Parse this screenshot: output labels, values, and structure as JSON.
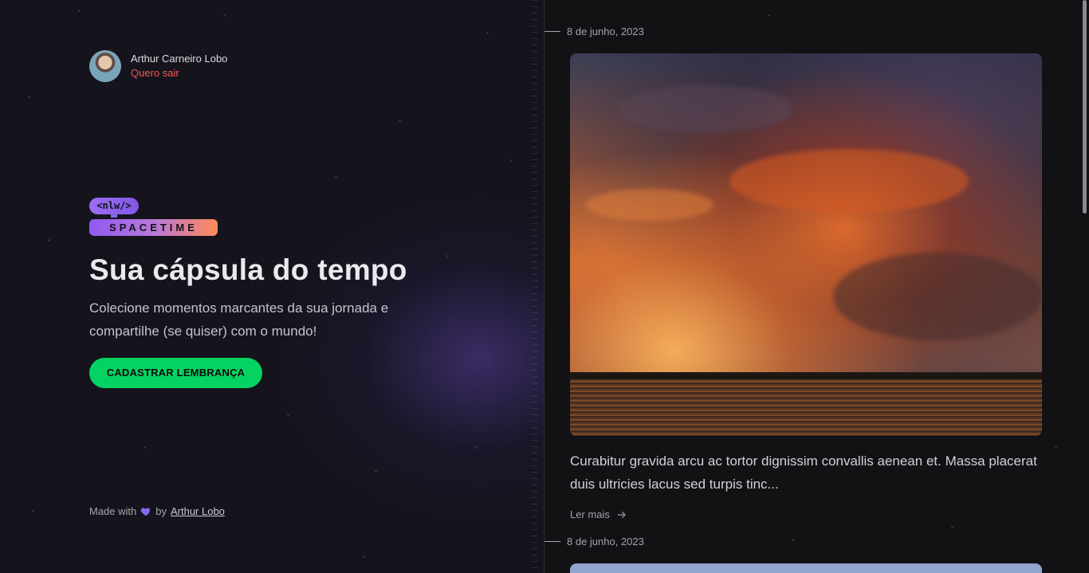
{
  "user": {
    "name": "Arthur Carneiro Lobo",
    "logout_label": "Quero sair"
  },
  "logo": {
    "top_text": "<nlw/>",
    "bottom_text": "SPACETIME"
  },
  "hero": {
    "title": "Sua cápsula do tempo",
    "subtitle": "Colecione momentos marcantes da sua jornada e compartilhe (se quiser) com o mundo!",
    "cta_label": "CADASTRAR LEMBRANÇA"
  },
  "footer": {
    "made_with": "Made with",
    "by": "by",
    "author_link": "Arthur Lobo",
    "heart_icon": "heart-icon"
  },
  "memories": [
    {
      "date": "8 de junho, 2023",
      "excerpt": "Curabitur gravida arcu ac tortor dignissim convallis aenean et. Massa placerat duis ultricies lacus sed turpis tinc...",
      "read_more_label": "Ler mais",
      "read_more_icon": "arrow-right-icon"
    },
    {
      "date": "8 de junho, 2023"
    }
  ],
  "colors": {
    "accent_green": "#04d361",
    "logout_red": "#ef5a5a",
    "purple": "#8257e5",
    "orange": "#ff8a57"
  }
}
